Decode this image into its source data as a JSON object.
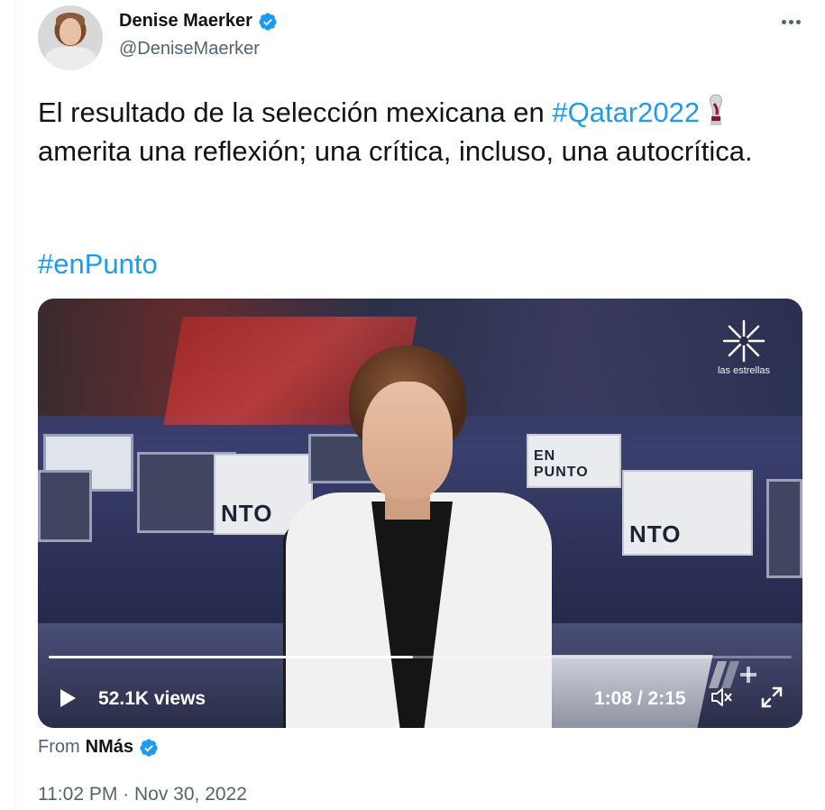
{
  "author": {
    "display_name": "Denise Maerker",
    "handle": "@DeniseMaerker",
    "verified_icon": "verified-badge-icon",
    "verified_color": "#1d9bf0"
  },
  "more_menu_icon": "more-horizontal-icon",
  "tweet": {
    "text_part1": "El resultado de la selección mexicana en ",
    "hashtag_qatar": "#Qatar2022",
    "trophy_emoji": "world-cup-trophy-icon",
    "text_part2": " amerita una reflexión; una crítica, incluso, una autocrítica.",
    "hashtag_enpunto": "#enPunto"
  },
  "video": {
    "broadcaster_logo_text": "las estrellas",
    "sign_text_1": "NTO",
    "sign_text_2": "EN PUNTO",
    "progress_fraction": 0.49,
    "views": "52.1K views",
    "time": "1:08 / 2:15"
  },
  "source": {
    "from_label": "From",
    "from_name": "NMás"
  },
  "timestamp": "11:02 PM · Nov 30, 2022",
  "colors": {
    "link": "#1d9bf0",
    "text": "#0f1419",
    "secondary": "#536471"
  }
}
